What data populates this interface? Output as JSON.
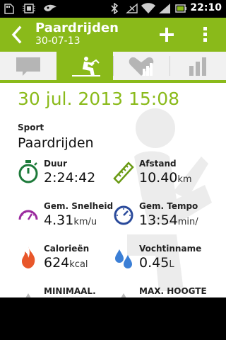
{
  "statusbar": {
    "time": "22:10",
    "icons": [
      "sd-card-icon",
      "chip-icon",
      "notification-icon",
      "bluetooth-icon",
      "no-signal-icon",
      "wifi-icon",
      "signal-icon",
      "battery-icon"
    ]
  },
  "actionbar": {
    "title": "Paardrijden",
    "subtitle": "30-07-13",
    "accent": "#8aba1a"
  },
  "tabs": [
    {
      "icon": "comment-icon",
      "selected": false
    },
    {
      "icon": "horse-riding-icon",
      "selected": true
    },
    {
      "icon": "heart-chart-icon",
      "selected": false
    },
    {
      "icon": "bar-chart-icon",
      "selected": false
    }
  ],
  "activity": {
    "datetime": "30 jul. 2013 15:08",
    "sport_label": "Sport",
    "sport_value": "Paardrijden"
  },
  "stats": {
    "duration": {
      "label": "Duur",
      "value": "2:24:42",
      "unit": ""
    },
    "distance": {
      "label": "Afstand",
      "value": "10.40",
      "unit": "km"
    },
    "avg_speed": {
      "label": "Gem. Snelheid",
      "value": "4.31",
      "unit": "km/u"
    },
    "avg_pace": {
      "label": "Gem. Tempo",
      "value": "13:54",
      "unit": "min/"
    },
    "calories": {
      "label": "Calorieën",
      "value": "624",
      "unit": "kcal"
    },
    "hydration": {
      "label": "Vochtinname",
      "value": "0.45",
      "unit": "L"
    },
    "min_altitude": {
      "label": "MINIMAAL."
    },
    "max_altitude": {
      "label": "MAX. HOOGTE"
    }
  }
}
